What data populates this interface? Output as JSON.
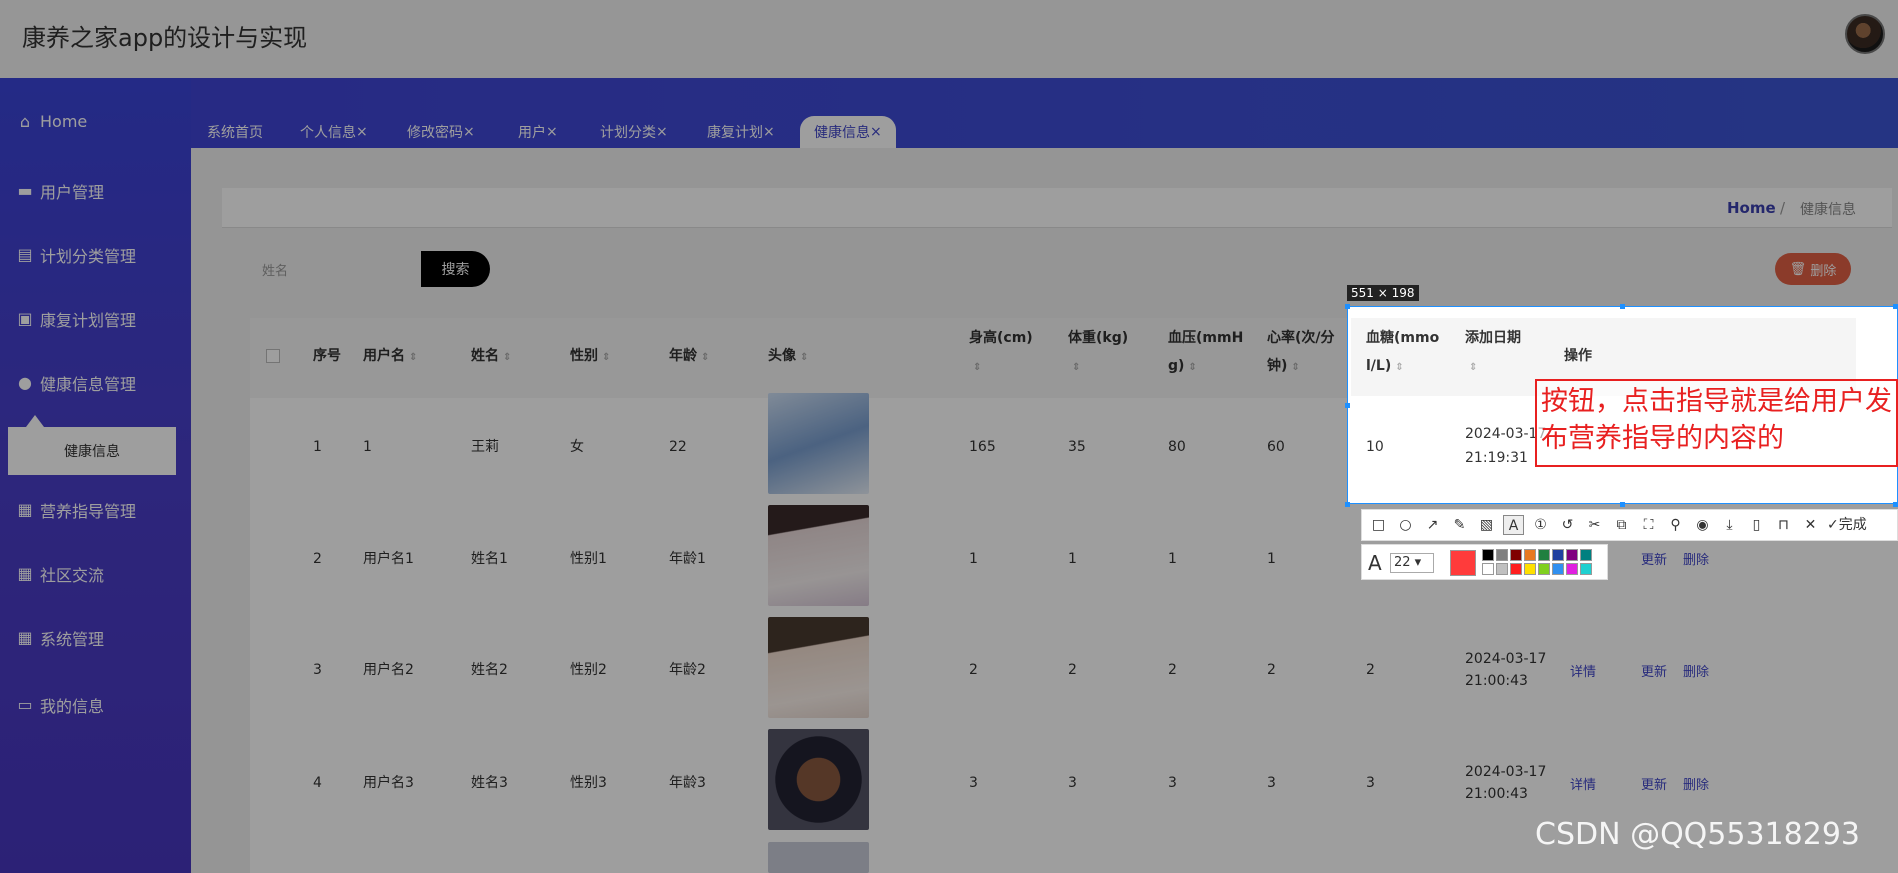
{
  "header": {
    "title": "康养之家app的设计与实现"
  },
  "sidebar": {
    "items": [
      {
        "label": "Home",
        "icon": "home-icon"
      },
      {
        "label": "用户管理",
        "icon": "chair-icon"
      },
      {
        "label": "计划分类管理",
        "icon": "clipboard-icon"
      },
      {
        "label": "康复计划管理",
        "icon": "briefcase-icon"
      },
      {
        "label": "健康信息管理",
        "icon": "user-icon"
      },
      {
        "label": "营养指导管理",
        "icon": "grid-icon"
      },
      {
        "label": "社区交流",
        "icon": "grid-icon"
      },
      {
        "label": "系统管理",
        "icon": "grid-icon"
      },
      {
        "label": "我的信息",
        "icon": "card-icon"
      }
    ],
    "submenu": {
      "label": "健康信息"
    }
  },
  "tabs": [
    {
      "label": "系统首页",
      "close": ""
    },
    {
      "label": "个人信息",
      "close": "×"
    },
    {
      "label": "修改密码",
      "close": "×"
    },
    {
      "label": "用户",
      "close": "×"
    },
    {
      "label": "计划分类",
      "close": "×"
    },
    {
      "label": "康复计划",
      "close": "×"
    },
    {
      "label": "健康信息",
      "close": "×"
    }
  ],
  "breadcrumb": {
    "home": "Home",
    "sep": "/",
    "current": "健康信息"
  },
  "search": {
    "label": "姓名",
    "placeholder": "",
    "button": "搜索"
  },
  "delete_button": "删除",
  "table": {
    "columns": [
      "序号",
      "用户名",
      "姓名",
      "性别",
      "年龄",
      "头像",
      "身高(cm)",
      "体重(kg)",
      "血压(mmHg)",
      "心率(次/分钟)",
      "血糖(mmol/L)",
      "添加日期",
      "操作"
    ],
    "rows": [
      {
        "no": "1",
        "username": "1",
        "name": "王莉",
        "gender": "女",
        "age": "22",
        "height": "165",
        "weight": "35",
        "bp": "80",
        "hr": "60",
        "sugar": "10",
        "date": "2024-03-17",
        "time": "21:19:31"
      },
      {
        "no": "2",
        "username": "用户名1",
        "name": "姓名1",
        "gender": "性别1",
        "age": "年龄1",
        "height": "1",
        "weight": "1",
        "bp": "1",
        "hr": "1",
        "sugar": "",
        "date": "",
        "time": ""
      },
      {
        "no": "3",
        "username": "用户名2",
        "name": "姓名2",
        "gender": "性别2",
        "age": "年龄2",
        "height": "2",
        "weight": "2",
        "bp": "2",
        "hr": "2",
        "sugar": "2",
        "date": "2024-03-17",
        "time": "21:00:43"
      },
      {
        "no": "4",
        "username": "用户名3",
        "name": "姓名3",
        "gender": "性别3",
        "age": "年龄3",
        "height": "3",
        "weight": "3",
        "bp": "3",
        "hr": "3",
        "sugar": "3",
        "date": "2024-03-17",
        "time": "21:00:43"
      }
    ],
    "actions": {
      "detail": "详情",
      "update": "更新",
      "delete": "删除"
    }
  },
  "screenshot_tool": {
    "size_label": "551 × 198",
    "annotation": "按钮，点击指导就是给用户发布营养指导的内容的",
    "font_size": "22",
    "done": "完成",
    "current_color": "#ff3b3b"
  },
  "watermark": "CSDN @QQ55318293"
}
